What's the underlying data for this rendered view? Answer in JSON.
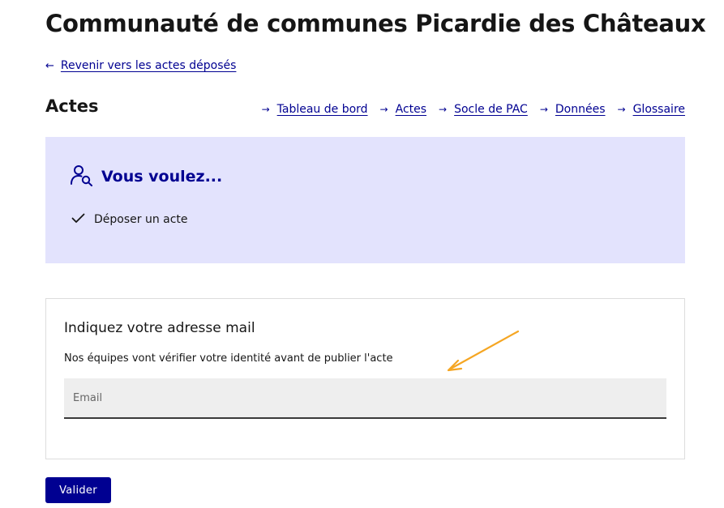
{
  "page": {
    "title": "Communauté de communes Picardie des Châteaux"
  },
  "back_link": {
    "label": "Revenir vers les actes déposés",
    "icon": "arrow-left-icon"
  },
  "section": {
    "title": "Actes"
  },
  "nav": {
    "items": [
      {
        "label": "Tableau de bord"
      },
      {
        "label": "Actes"
      },
      {
        "label": "Socle de PAC"
      },
      {
        "label": "Données"
      },
      {
        "label": "Glossaire"
      }
    ],
    "icon": "arrow-right-icon"
  },
  "callout": {
    "title": "Vous voulez...",
    "icon": "user-search-icon",
    "item": "Déposer un acte",
    "item_icon": "checkmark-icon",
    "background": "#e3e3fd",
    "accent": "#000091"
  },
  "form": {
    "title": "Indiquez votre adresse mail",
    "hint": "Nos équipes vont vérifier votre identité avant de publier l'acte",
    "email_placeholder": "Email",
    "email_value": ""
  },
  "submit": {
    "label": "Valider",
    "color": "#000091"
  },
  "annotation": {
    "icon": "arrow-annotation",
    "color": "#f5a623"
  }
}
